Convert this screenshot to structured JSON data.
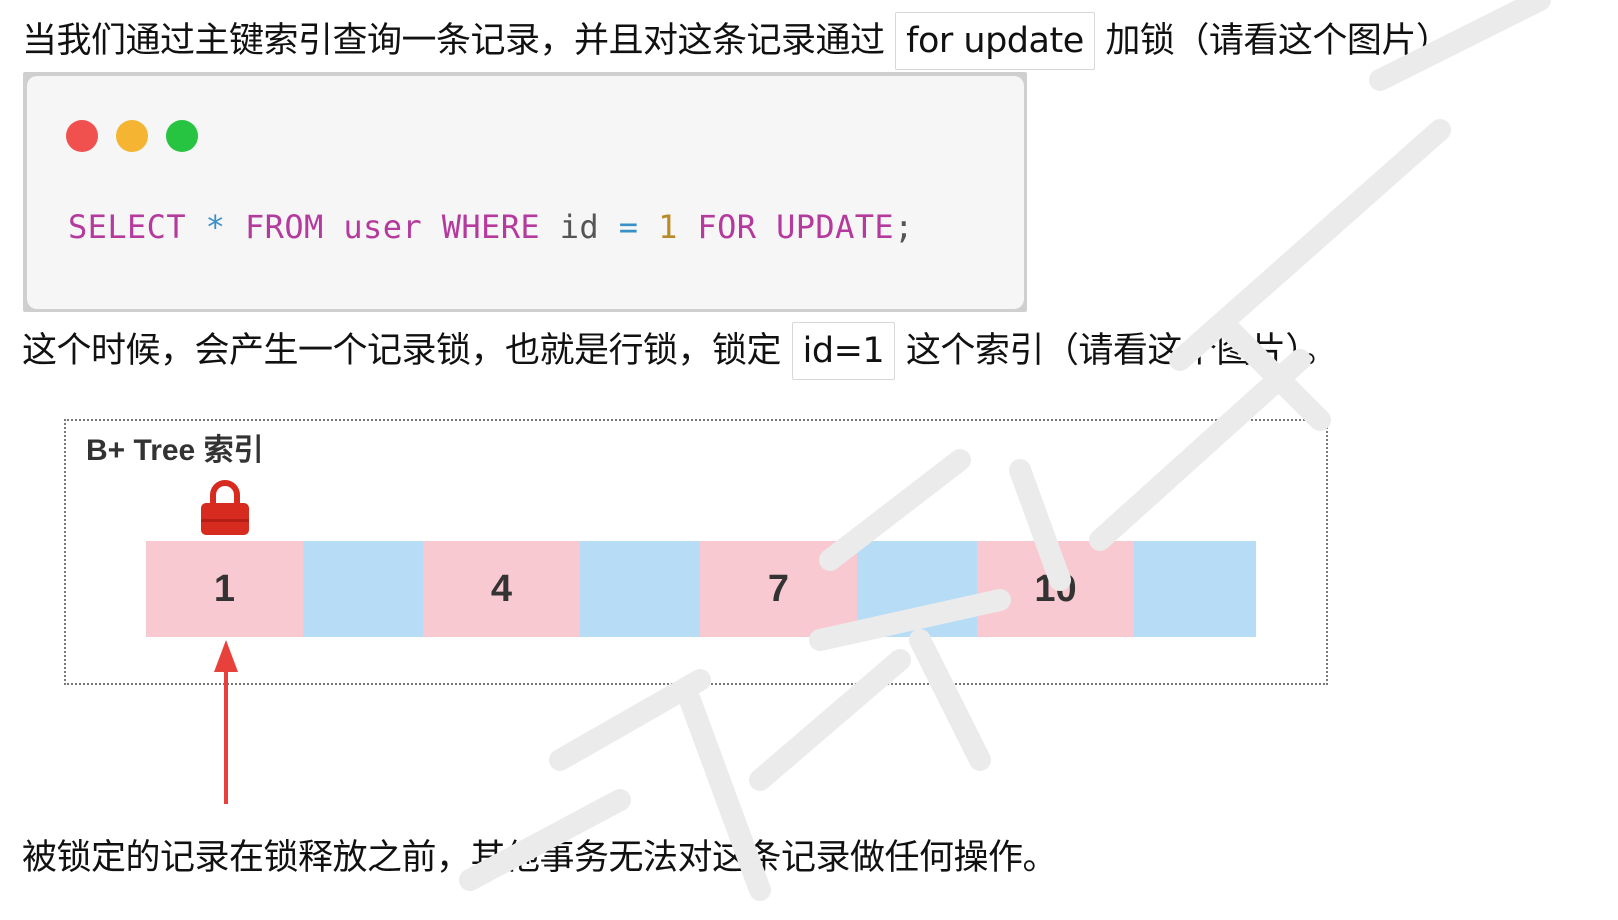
{
  "paragraph1": {
    "before": "当我们通过主键索引查询一条记录，并且对这条记录通过",
    "code": "for update",
    "after": "加锁（请看这个图片）"
  },
  "code_block": {
    "tokens": {
      "select": "SELECT",
      "star": "*",
      "from": "FROM",
      "table": "user",
      "where": "WHERE",
      "column": "id",
      "eq": "=",
      "value": "1",
      "for_update": "FOR UPDATE",
      "semicolon": ";"
    },
    "colors": {
      "keyword": "#b53a9e",
      "operator": "#3a8fc9",
      "identifier": "#555555",
      "number": "#b98a2a"
    }
  },
  "paragraph2": {
    "before": "这个时候，会产生一个记录锁，也就是行锁，锁定",
    "code": "id=1",
    "after": "这个索引（请看这个图片）。"
  },
  "diagram": {
    "title": "B+ Tree 索引",
    "cells": [
      "1",
      "",
      "4",
      "",
      "7",
      "",
      "10",
      ""
    ],
    "locked_value": "1",
    "colors": {
      "key_cell": "#f9c9d1",
      "gap_cell": "#b7dcf6",
      "lock": "#d62b1e",
      "arrow": "#e8403a"
    }
  },
  "paragraph3": {
    "text": "被锁定的记录在锁释放之前，其他事务无法对这条记录做任何操作。"
  }
}
